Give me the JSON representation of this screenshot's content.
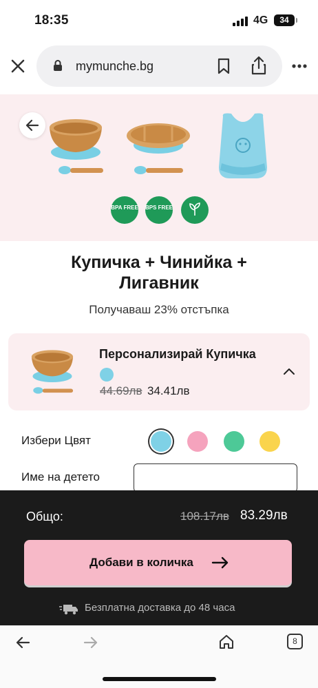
{
  "status": {
    "time": "18:35",
    "network": "4G",
    "battery": "34"
  },
  "browser": {
    "url": "mymunche.bg",
    "tab_count": "8"
  },
  "hero": {
    "badges": [
      {
        "text": "BPA FREE",
        "color": "#1f9a58"
      },
      {
        "text": "BPS FREE",
        "color": "#1f9a58"
      },
      {
        "text": "",
        "color": "#1f9a58"
      }
    ]
  },
  "product": {
    "title_line1": "Купичка + Чинийка +",
    "title_line2": "Лигавник",
    "discount_text": "Получаваш 23% отстъпка"
  },
  "item_card": {
    "title": "Персонализирай Купичка",
    "swatch_color": "#7fd1e6",
    "old_price": "44.69лв",
    "new_price": "34.41лв"
  },
  "options": {
    "color_label": "Избери Цвят",
    "colors": [
      "#7fd1e6",
      "#f5a3bd",
      "#4dc997",
      "#fad44d"
    ],
    "selected_color_index": 0,
    "name_label": "Име на детето",
    "name_value": "",
    "name_placeholder": ""
  },
  "summary": {
    "total_label": "Общо:",
    "old_total": "108.17лв",
    "new_total": "83.29лв",
    "add_button": "Добави в количка",
    "delivery_text": "Безплатна доставка до 48 часа"
  },
  "colors": {
    "accent": "#f7b9c8",
    "hero_bg": "#fbeef0",
    "footer_bg": "#1b1b1b",
    "bamboo": "#c98a45",
    "silicone_blue": "#7fd1e6"
  }
}
